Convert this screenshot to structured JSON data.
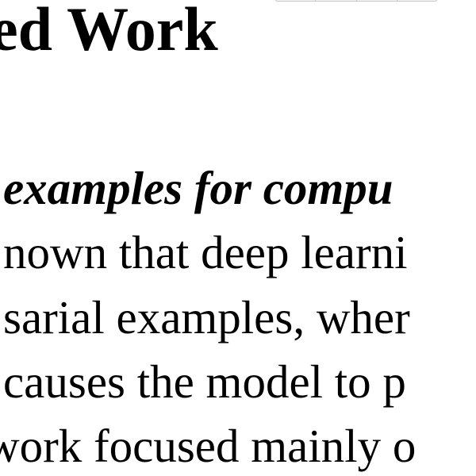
{
  "document": {
    "section_heading": "ed Work",
    "subheading": "examples for compu",
    "body_lines": [
      "nown that deep learni",
      "sarial examples, wher",
      "causes the model to p",
      "work focused mainly o"
    ]
  }
}
